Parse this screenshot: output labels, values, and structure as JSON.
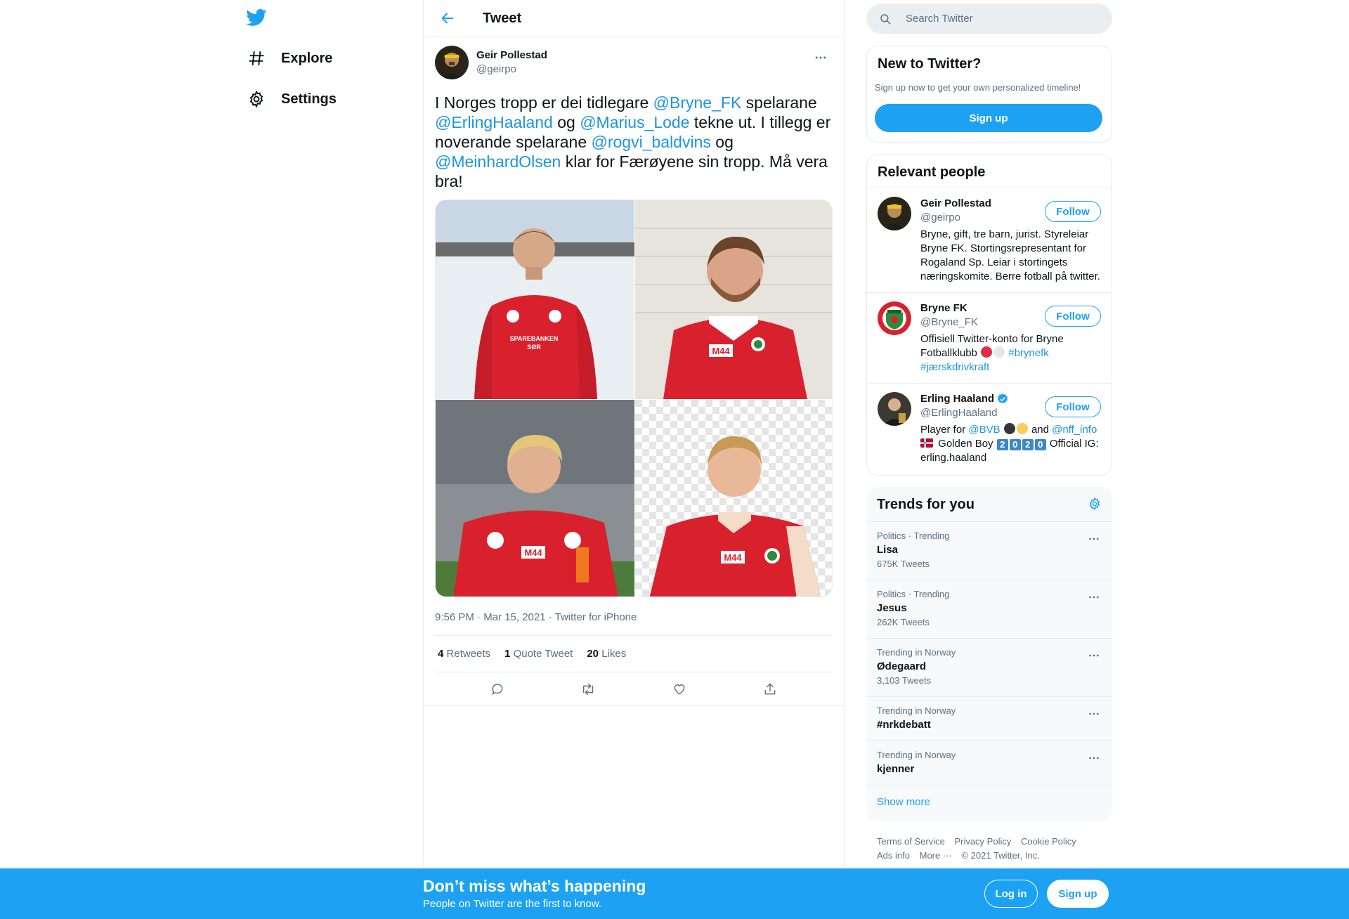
{
  "nav": {
    "explore_label": "Explore",
    "settings_label": "Settings"
  },
  "header": {
    "title": "Tweet"
  },
  "tweet": {
    "author_name": "Geir Pollestad",
    "author_handle": "@geirpo",
    "text_parts": {
      "t1": "I Norges tropp er dei tidlegare ",
      "m1": "@Bryne_FK",
      "t2": " spelarane ",
      "m2": "@ErlingHaaland",
      "t3": " og ",
      "m3": "@Marius_Lode",
      "t4": " tekne ut. I tillegg er noverande spelarane ",
      "m4": "@rogvi_baldvins",
      "t5": " og ",
      "m5": "@MeinhardOlsen",
      "t6": " klar for Færøyene sin tropp. Må vera bra!"
    },
    "meta": "9:56 PM · Mar 15, 2021 · Twitter for iPhone",
    "stats": {
      "retweets_count": "4",
      "retweets_label": "Retweets",
      "quotes_count": "1",
      "quotes_label": "Quote Tweet",
      "likes_count": "20",
      "likes_label": "Likes"
    }
  },
  "search": {
    "placeholder": "Search Twitter"
  },
  "new_to_twitter": {
    "title": "New to Twitter?",
    "subtitle": "Sign up now to get your own personalized timeline!",
    "button": "Sign up"
  },
  "relevant": {
    "title": "Relevant people",
    "people": [
      {
        "name": "Geir Pollestad",
        "handle": "@geirpo",
        "bio": "Bryne, gift, tre barn, jurist. Styreleiar Bryne FK. Stortingsrepresentant for Rogaland Sp. Leiar i stortingets næringskomite. Berre fotball på twitter.",
        "follow": "Follow"
      },
      {
        "name": "Bryne FK",
        "handle": "@Bryne_FK",
        "bio_text": "Offisiell Twitter-konto for Bryne Fotballklubb ",
        "hashtag1": "#brynefk",
        "hashtag2": "#jærskdrivkraft",
        "follow": "Follow"
      },
      {
        "name": "Erling Haaland",
        "handle": "@ErlingHaaland",
        "bio_player": "Player for ",
        "bio_bvb": "@BVB",
        "bio_and": " and ",
        "bio_nff": "@nff_info",
        "bio_golden": " Golden Boy ",
        "bio_year_digits": [
          "2",
          "0",
          "2",
          "0"
        ],
        "bio_rest": " Official IG: erling.haaland",
        "follow": "Follow"
      }
    ]
  },
  "trends": {
    "title": "Trends for you",
    "items": [
      {
        "context": "Politics · Trending",
        "name": "Lisa",
        "count": "675K Tweets"
      },
      {
        "context": "Politics · Trending",
        "name": "Jesus",
        "count": "262K Tweets"
      },
      {
        "context": "Trending in Norway",
        "name": "Ødegaard",
        "count": "3,103 Tweets"
      },
      {
        "context": "Trending in Norway",
        "name": "#nrkdebatt",
        "count": ""
      },
      {
        "context": "Trending in Norway",
        "name": "kjenner",
        "count": ""
      }
    ],
    "show_more": "Show more"
  },
  "footer": {
    "terms": "Terms of Service",
    "privacy": "Privacy Policy",
    "cookie": "Cookie Policy",
    "ads": "Ads info",
    "more": "More ···",
    "copyright": "© 2021 Twitter, Inc."
  },
  "bottom_bar": {
    "title": "Don’t miss what’s happening",
    "subtitle": "People on Twitter are the first to know.",
    "login": "Log in",
    "signup": "Sign up"
  },
  "colors": {
    "brand_blue": "#1da1f2",
    "link_blue": "#1b95e0",
    "text_secondary": "#5b7083",
    "jersey_red": "#d9212e"
  }
}
